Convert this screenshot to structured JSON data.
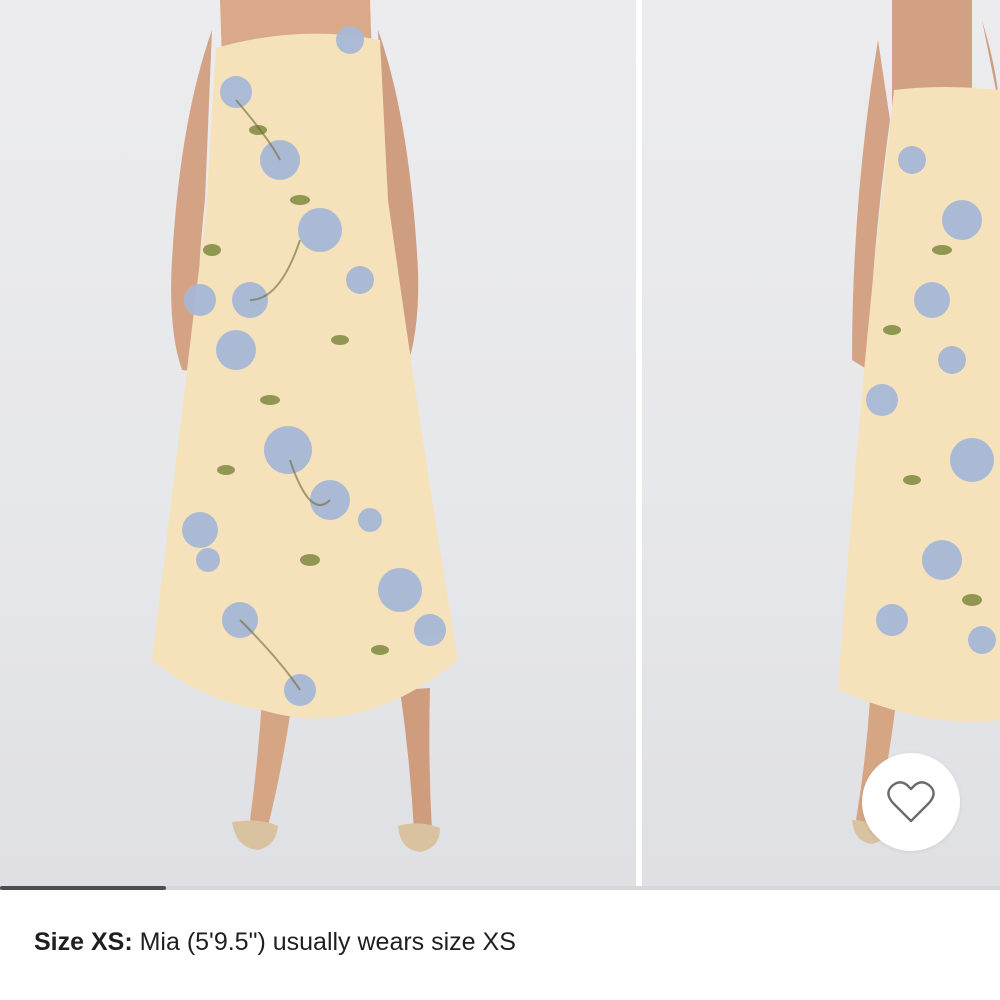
{
  "gallery": {
    "images": [
      {
        "alt": "front view",
        "icon": "model-front-photo"
      },
      {
        "alt": "back view",
        "icon": "model-back-photo"
      }
    ],
    "scroll_progress": 0.166,
    "colors": {
      "dress": "#f5e2bb",
      "flower": "#a8b8d6",
      "leaf": "#7f8a3f",
      "skin": "#d6a685",
      "background": "#e9eaec"
    }
  },
  "wishlist": {
    "icon": "heart-outline-icon"
  },
  "size_info": {
    "label": "Size XS:",
    "text": " Mia (5'9.5\") usually wears size XS"
  }
}
